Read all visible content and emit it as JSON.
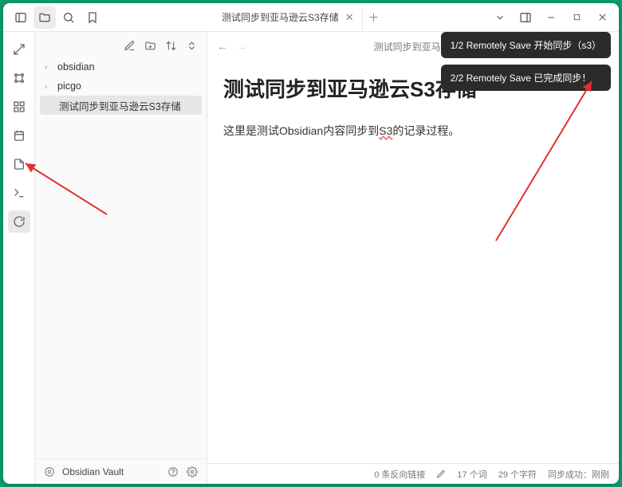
{
  "tab": {
    "title": "测试同步到亚马逊云S3存储"
  },
  "breadcrumb": "测试同步到亚马逊云S3存储",
  "sidebar": {
    "folders": [
      {
        "name": "obsidian"
      },
      {
        "name": "picgo"
      }
    ],
    "files": [
      {
        "name": "测试同步到亚马逊云S3存储"
      }
    ]
  },
  "vault": {
    "name": "Obsidian Vault"
  },
  "document": {
    "title_prefix": "测试同步到亚马逊云",
    "title_bold": "S3存储",
    "body_a": "这里是测试Obsidian内容同步到",
    "body_b": "S3",
    "body_c": "的记录过程。"
  },
  "status": {
    "backlinks": "0 条反向链接",
    "words": "17 个词",
    "chars": "29 个字符",
    "sync": "同步成功：刚刚"
  },
  "toasts": [
    "1/2 Remotely Save 开始同步（s3）",
    "2/2 Remotely Save 已完成同步！"
  ]
}
